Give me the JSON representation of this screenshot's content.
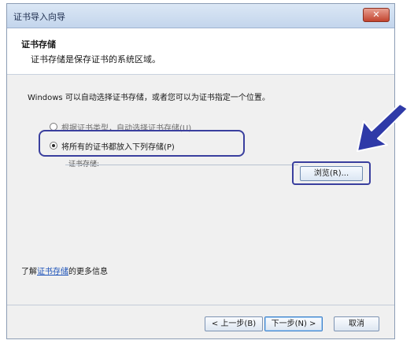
{
  "window": {
    "title": "证书导入向导",
    "close_label": "✕"
  },
  "header": {
    "title": "证书存储",
    "subtitle": "证书存储是保存证书的系统区域。"
  },
  "intro_text": "Windows 可以自动选择证书存储，或者您可以为证书指定一个位置。",
  "options": {
    "auto_label": "根据证书类型，自动选择证书存储(U)",
    "manual_label": "将所有的证书都放入下列存储(P)",
    "selected": "manual"
  },
  "store": {
    "label": "证书存储:",
    "value": ""
  },
  "browse_label": "浏览(R)...",
  "learn_more": {
    "prefix": "了解",
    "link": "证书存储",
    "suffix": "的更多信息"
  },
  "footer": {
    "back_label": "< 上一步(B)",
    "next_label": "下一步(N) >",
    "cancel_label": "取消"
  },
  "colors": {
    "highlight": "#3a3f9e",
    "arrow": "#2f3aa8",
    "link": "#1d52b8"
  },
  "icons": {
    "pointer": "arrow-icon"
  }
}
